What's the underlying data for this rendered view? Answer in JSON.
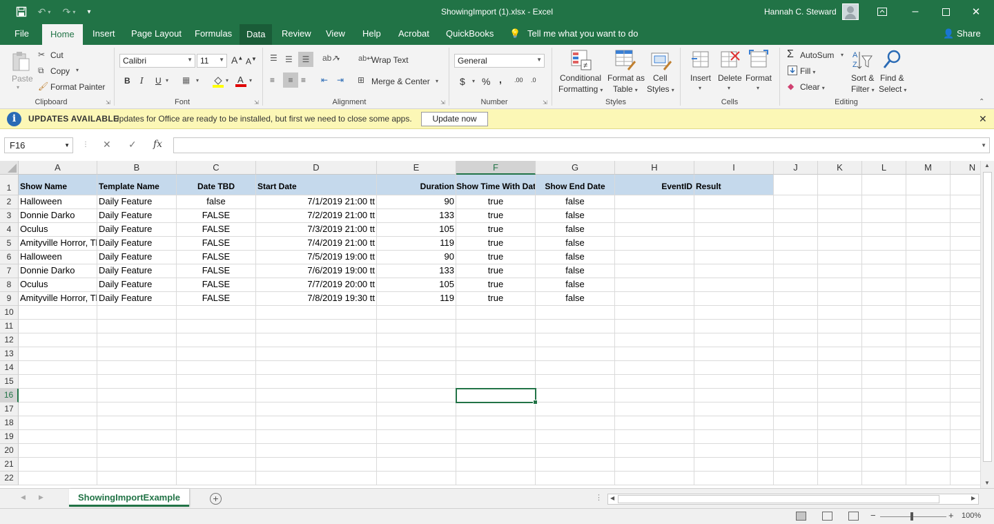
{
  "window": {
    "title": "ShowingImport (1).xlsx  -  Excel",
    "user": "Hannah C. Steward"
  },
  "menu": {
    "tabs": [
      "File",
      "Home",
      "Insert",
      "Page Layout",
      "Formulas",
      "Data",
      "Review",
      "View",
      "Help",
      "Acrobat",
      "QuickBooks"
    ],
    "active_tab": "Home",
    "tell_me": "Tell me what you want to do",
    "share": "Share"
  },
  "ribbon": {
    "clipboard": {
      "paste": "Paste",
      "cut": "Cut",
      "copy": "Copy",
      "format_painter": "Format Painter",
      "label": "Clipboard"
    },
    "font": {
      "name": "Calibri",
      "size": "11",
      "bold": "B",
      "italic": "I",
      "underline": "U",
      "grow": "A",
      "shrink": "A",
      "label": "Font"
    },
    "alignment": {
      "wrap": "Wrap Text",
      "merge": "Merge & Center",
      "label": "Alignment"
    },
    "number": {
      "format": "General",
      "currency": "$",
      "percent": "%",
      "comma": ",",
      "inc_dec": ".00",
      "dec_dec": ".0",
      "label": "Number"
    },
    "styles": {
      "conditional": "Conditional",
      "conditional2": "Formatting",
      "format_table": "Format as",
      "format_table2": "Table",
      "cell_styles": "Cell",
      "cell_styles2": "Styles",
      "label": "Styles"
    },
    "cells": {
      "insert": "Insert",
      "delete": "Delete",
      "format": "Format",
      "label": "Cells"
    },
    "editing": {
      "autosum": "AutoSum",
      "fill": "Fill",
      "clear": "Clear",
      "sort": "Sort &",
      "sort2": "Filter",
      "find": "Find &",
      "find2": "Select",
      "label": "Editing"
    }
  },
  "update_bar": {
    "title": "UPDATES AVAILABLE",
    "message": "Updates for Office are ready to be installed, but first we need to close some apps.",
    "button": "Update now"
  },
  "formula_bar": {
    "name_box": "F16",
    "formula": "",
    "fx": "fx"
  },
  "grid": {
    "columns": [
      "A",
      "B",
      "C",
      "D",
      "E",
      "F",
      "G",
      "H",
      "I",
      "J",
      "K",
      "L",
      "M",
      "N"
    ],
    "selected_col": "F",
    "selected_row": 16,
    "rows": [
      1,
      2,
      3,
      4,
      5,
      6,
      7,
      8,
      9,
      10,
      11,
      12,
      13,
      14,
      15,
      16,
      17,
      18,
      19,
      20,
      21,
      22
    ],
    "header_row": [
      "Show Name",
      "Template Name",
      "Date TBD",
      "Start Date",
      "Duration",
      "Show Time With Date",
      "Show End Date",
      "EventID",
      "Result"
    ],
    "data_rows": [
      [
        "Halloween",
        "Daily Feature",
        "false",
        "7/1/2019 21:00 tt",
        "90",
        "true",
        "false",
        "",
        ""
      ],
      [
        "Donnie Darko",
        "Daily Feature",
        "FALSE",
        "7/2/2019 21:00 tt",
        "133",
        "true",
        "false",
        "",
        ""
      ],
      [
        "Oculus",
        "Daily Feature",
        "FALSE",
        "7/3/2019 21:00 tt",
        "105",
        "true",
        "false",
        "",
        ""
      ],
      [
        "Amityville Horror, The",
        "Daily Feature",
        "FALSE",
        "7/4/2019 21:00 tt",
        "119",
        "true",
        "false",
        "",
        ""
      ],
      [
        "Halloween",
        "Daily Feature",
        "FALSE",
        "7/5/2019 19:00 tt",
        "90",
        "true",
        "false",
        "",
        ""
      ],
      [
        "Donnie Darko",
        "Daily Feature",
        "FALSE",
        "7/6/2019 19:00 tt",
        "133",
        "true",
        "false",
        "",
        ""
      ],
      [
        "Oculus",
        "Daily Feature",
        "FALSE",
        "7/7/2019 20:00 tt",
        "105",
        "true",
        "false",
        "",
        ""
      ],
      [
        "Amityville Horror, The",
        "Daily Feature",
        "FALSE",
        "7/8/2019 19:30 tt",
        "119",
        "true",
        "false",
        "",
        ""
      ]
    ]
  },
  "sheets": {
    "active": "ShowingImportExample"
  },
  "status": {
    "zoom": "100%",
    "zoom_minus": "−",
    "zoom_plus": "+"
  }
}
